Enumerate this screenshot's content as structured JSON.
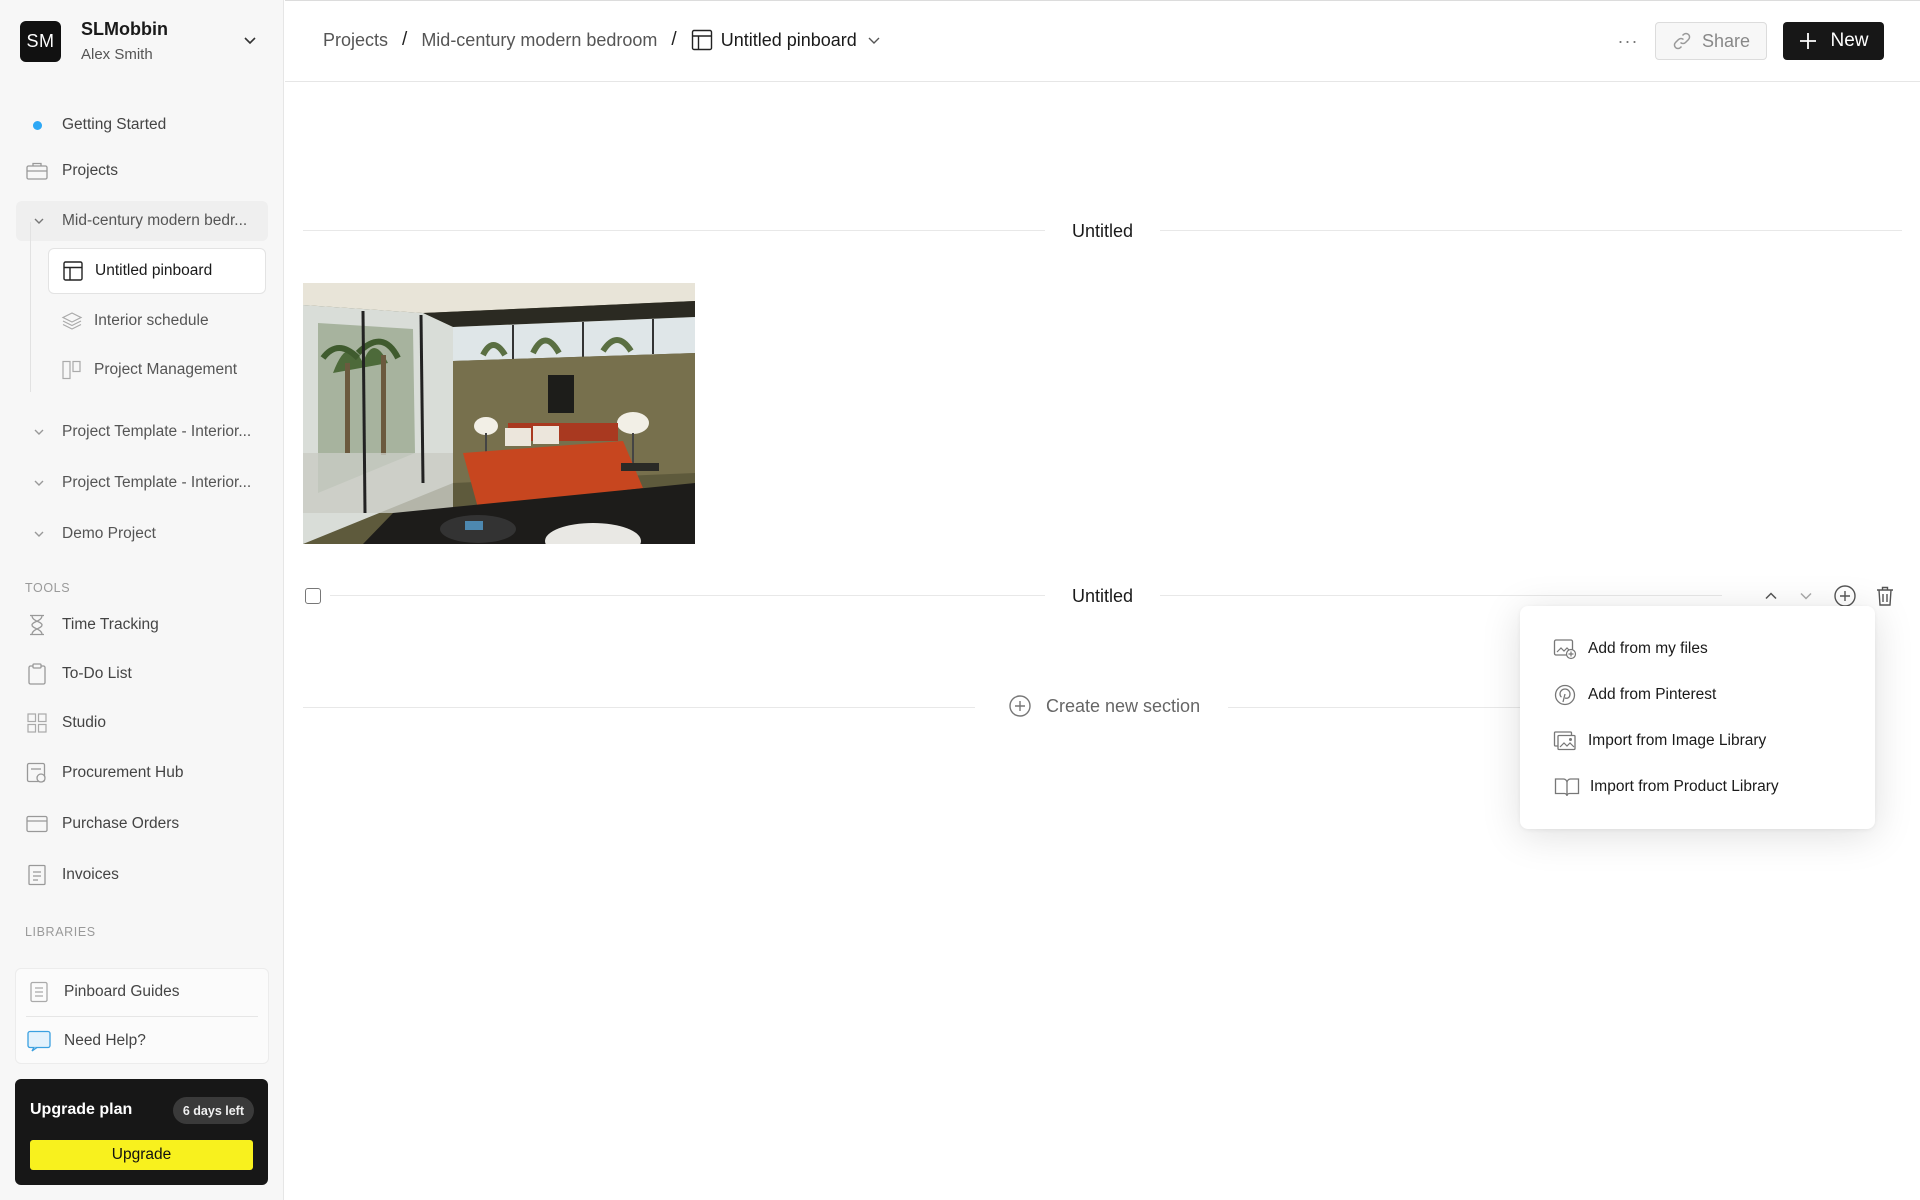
{
  "workspace": {
    "initials": "SM",
    "name": "SLMobbin",
    "user": "Alex Smith"
  },
  "nav": {
    "getting_started": "Getting Started",
    "projects": "Projects"
  },
  "projects": [
    {
      "label": "Mid-century modern bedr...",
      "expanded": true
    },
    {
      "label": "Project Template - Interior..."
    },
    {
      "label": "Project Template - Interior..."
    },
    {
      "label": "Demo Project"
    }
  ],
  "project_pages": [
    {
      "label": "Untitled pinboard",
      "icon": "pinboard-icon",
      "active": true
    },
    {
      "label": "Interior schedule",
      "icon": "layers-icon"
    },
    {
      "label": "Project Management",
      "icon": "kanban-icon"
    }
  ],
  "tools": {
    "heading": "TOOLS",
    "items": [
      {
        "label": "Time Tracking",
        "icon": "hourglass-icon"
      },
      {
        "label": "To-Do List",
        "icon": "clipboard-icon"
      },
      {
        "label": "Studio",
        "icon": "grid-icon"
      },
      {
        "label": "Procurement Hub",
        "icon": "procurement-icon"
      },
      {
        "label": "Purchase Orders",
        "icon": "card-icon"
      },
      {
        "label": "Invoices",
        "icon": "receipt-icon"
      }
    ]
  },
  "libraries": {
    "heading": "LIBRARIES",
    "items": [
      {
        "label": "Pinboard Guides",
        "icon": "guide-icon"
      },
      {
        "label": "Need Help?",
        "icon": "chat-icon"
      }
    ]
  },
  "upgrade": {
    "title": "Upgrade plan",
    "badge": "6 days left",
    "button": "Upgrade",
    "button_color": "#f8f11e"
  },
  "header": {
    "breadcrumb": [
      "Projects",
      "Mid-century modern bedroom",
      "Untitled pinboard"
    ],
    "separator": "/",
    "more": "···",
    "share_label": "Share",
    "new_label": "New"
  },
  "sections": [
    {
      "title": "Untitled"
    },
    {
      "title": "Untitled"
    }
  ],
  "create_section_label": "Create new section",
  "add_menu": [
    {
      "label": "Add from my files",
      "icon": "add-file-image-icon"
    },
    {
      "label": "Add from Pinterest",
      "icon": "pinterest-icon"
    },
    {
      "label": "Import from Image Library",
      "icon": "image-library-icon"
    },
    {
      "label": "Import from Product Library",
      "icon": "book-icon"
    }
  ],
  "colors": {
    "accent_dot": "#2ea8f5",
    "dark": "#171717"
  }
}
